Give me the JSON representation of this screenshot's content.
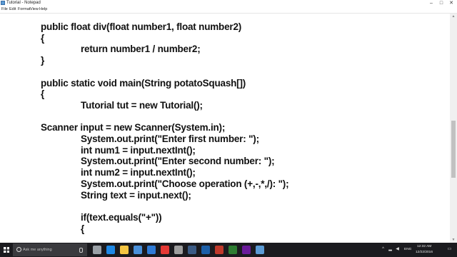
{
  "window": {
    "title": "Tutorial - Notepad",
    "minimize": "–",
    "maximize": "□",
    "close": "✕"
  },
  "menu": [
    "File",
    "Edit",
    "Format",
    "View",
    "Help"
  ],
  "code_lines": [
    "public float div(float number1, float number2)",
    "{",
    "\t\treturn number1 / number2;",
    "}",
    "",
    "public static void main(String potatoSquash[])",
    "{",
    "\t\tTutorial tut = new Tutorial();",
    "",
    "Scanner input = new Scanner(System.in);",
    "\t\tSystem.out.print(\"Enter first number: \");",
    "\t\tint num1 = input.nextInt();",
    "\t\tSystem.out.print(\"Enter second number: \");",
    "\t\tint num2 = input.nextInt();",
    "\t\tSystem.out.print(\"Choose operation (+,-,*,/): \");",
    "\t\tString text = input.next();",
    "",
    "\t\tif(text.equals(\"+\"))",
    "\t\t{"
  ],
  "taskbar": {
    "search_placeholder": "Ask me anything",
    "apps": [
      {
        "name": "task-view-icon",
        "color": "#9aa0a6"
      },
      {
        "name": "edge-icon",
        "color": "#1e88e5"
      },
      {
        "name": "file-explorer-icon",
        "color": "#f4c542"
      },
      {
        "name": "store-icon",
        "color": "#4a90d9"
      },
      {
        "name": "mail-icon",
        "color": "#2f7bd6"
      },
      {
        "name": "chrome-icon",
        "color": "#e53935"
      },
      {
        "name": "settings-icon",
        "color": "#9e9e9e"
      },
      {
        "name": "steam-icon",
        "color": "#3b5b85"
      },
      {
        "name": "photoshop-icon",
        "color": "#1c5fa8"
      },
      {
        "name": "app-icon-10",
        "color": "#c0392b"
      },
      {
        "name": "app-icon-11",
        "color": "#2e7d32"
      },
      {
        "name": "app-icon-12",
        "color": "#6a1b9a"
      },
      {
        "name": "notepad-icon",
        "color": "#5b9bd5"
      }
    ],
    "language": "ENG",
    "time": "12:32 AM",
    "date": "12/22/2016"
  }
}
